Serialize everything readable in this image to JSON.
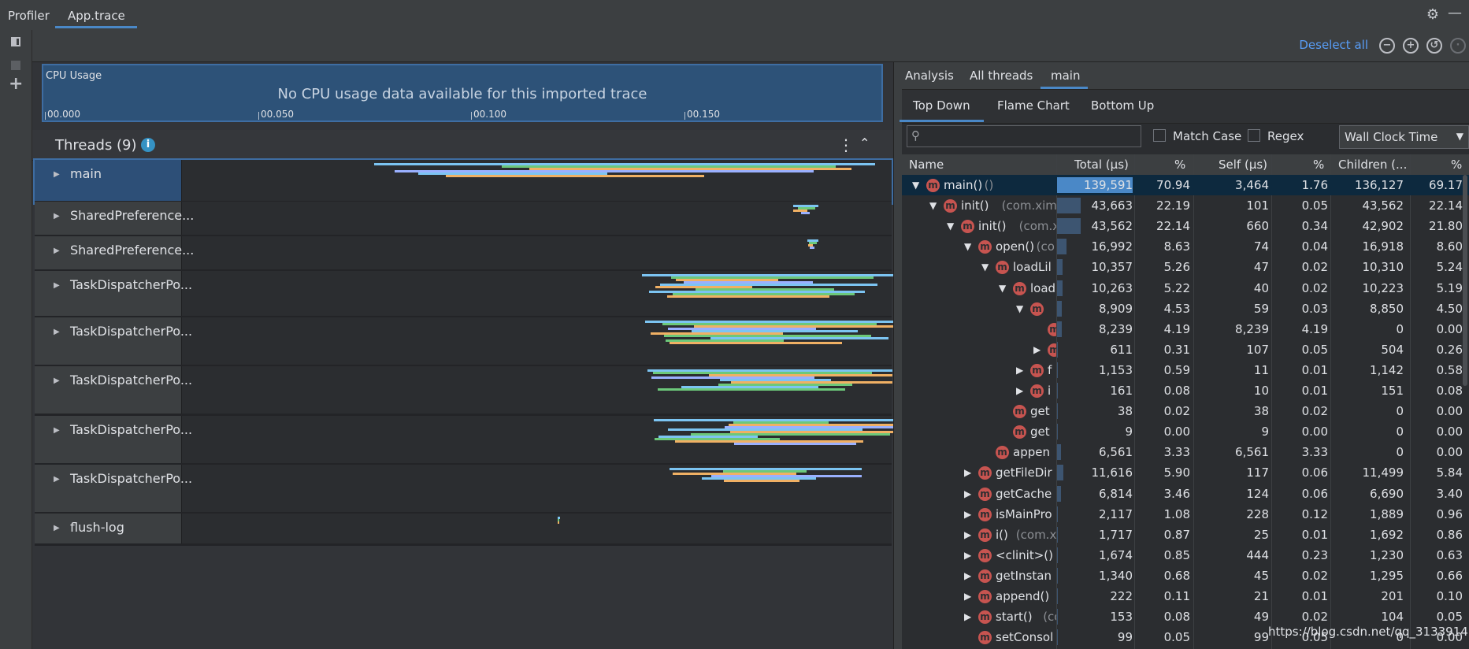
{
  "window": {
    "tabs": [
      "Profiler",
      "App.trace"
    ],
    "active_tab": "App.trace"
  },
  "toolbar": {
    "deselect_all": "Deselect all",
    "icons": [
      "zoom-out-icon",
      "zoom-in-icon",
      "reset-zoom-icon",
      "jump-to-live-icon"
    ]
  },
  "left_rail": {
    "icons": [
      "sessions-panel-icon",
      "stop-icon",
      "add-icon"
    ]
  },
  "cpu_usage": {
    "label": "CPU Usage",
    "message": "No CPU usage data available for this imported trace",
    "ticks": [
      "00.000",
      "00.050",
      "00.100",
      "00.150"
    ]
  },
  "threads": {
    "title": "Threads (9)",
    "rows": [
      {
        "name": "main"
      },
      {
        "name": "SharedPreference..."
      },
      {
        "name": "SharedPreference..."
      },
      {
        "name": "TaskDispatcherPo..."
      },
      {
        "name": "TaskDispatcherPo..."
      },
      {
        "name": "TaskDispatcherPo..."
      },
      {
        "name": "TaskDispatcherPo..."
      },
      {
        "name": "TaskDispatcherPo..."
      },
      {
        "name": "flush-log"
      }
    ]
  },
  "analysis": {
    "tabs": [
      "Analysis",
      "All threads",
      "main"
    ],
    "active_tab": "main",
    "subtabs": [
      "Top Down",
      "Flame Chart",
      "Bottom Up"
    ],
    "active_subtab": "Top Down",
    "search_placeholder": "",
    "match_case_label": "Match Case",
    "regex_label": "Regex",
    "clock_select": "Wall Clock Time",
    "columns": [
      "Name",
      "Total (μs)",
      "%",
      "Self (μs)",
      "%",
      "Children (...",
      "%"
    ],
    "rows": [
      {
        "name": "main()",
        "extra": " ()",
        "total": "139,591",
        "tpct": "70.94",
        "self": "3,464",
        "spct": "1.76",
        "children": "136,127",
        "cpct": "69.17"
      },
      {
        "name": "init()",
        "extra": " (com.ximal",
        "total": "43,663",
        "tpct": "22.19",
        "self": "101",
        "spct": "0.05",
        "children": "43,562",
        "cpct": "22.14"
      },
      {
        "name": "init()",
        "extra": " (com.xi",
        "total": "43,562",
        "tpct": "22.14",
        "self": "660",
        "spct": "0.34",
        "children": "42,902",
        "cpct": "21.80"
      },
      {
        "name": "open()",
        "extra": " (co",
        "total": "16,992",
        "tpct": "8.63",
        "self": "74",
        "spct": "0.04",
        "children": "16,918",
        "cpct": "8.60"
      },
      {
        "name": "loadLil",
        "extra": "",
        "total": "10,357",
        "tpct": "5.26",
        "self": "47",
        "spct": "0.02",
        "children": "10,310",
        "cpct": "5.24"
      },
      {
        "name": "load",
        "extra": "",
        "total": "10,263",
        "tpct": "5.22",
        "self": "40",
        "spct": "0.02",
        "children": "10,223",
        "cpct": "5.19"
      },
      {
        "name": "",
        "extra": "",
        "total": "8,909",
        "tpct": "4.53",
        "self": "59",
        "spct": "0.03",
        "children": "8,850",
        "cpct": "4.50"
      },
      {
        "name": "",
        "extra": "",
        "total": "8,239",
        "tpct": "4.19",
        "self": "8,239",
        "spct": "4.19",
        "children": "0",
        "cpct": "0.00"
      },
      {
        "name": "",
        "extra": "",
        "total": "611",
        "tpct": "0.31",
        "self": "107",
        "spct": "0.05",
        "children": "504",
        "cpct": "0.26"
      },
      {
        "name": "f",
        "extra": "",
        "total": "1,153",
        "tpct": "0.59",
        "self": "11",
        "spct": "0.01",
        "children": "1,142",
        "cpct": "0.58"
      },
      {
        "name": "i",
        "extra": "",
        "total": "161",
        "tpct": "0.08",
        "self": "10",
        "spct": "0.01",
        "children": "151",
        "cpct": "0.08"
      },
      {
        "name": "get",
        "extra": "",
        "total": "38",
        "tpct": "0.02",
        "self": "38",
        "spct": "0.02",
        "children": "0",
        "cpct": "0.00"
      },
      {
        "name": "get",
        "extra": "",
        "total": "9",
        "tpct": "0.00",
        "self": "9",
        "spct": "0.00",
        "children": "0",
        "cpct": "0.00"
      },
      {
        "name": "appen",
        "extra": "",
        "total": "6,561",
        "tpct": "3.33",
        "self": "6,561",
        "spct": "3.33",
        "children": "0",
        "cpct": "0.00"
      },
      {
        "name": "getFileDir",
        "extra": "",
        "total": "11,616",
        "tpct": "5.90",
        "self": "117",
        "spct": "0.06",
        "children": "11,499",
        "cpct": "5.84"
      },
      {
        "name": "getCache",
        "extra": "",
        "total": "6,814",
        "tpct": "3.46",
        "self": "124",
        "spct": "0.06",
        "children": "6,690",
        "cpct": "3.40"
      },
      {
        "name": "isMainPro",
        "extra": "",
        "total": "2,117",
        "tpct": "1.08",
        "self": "228",
        "spct": "0.12",
        "children": "1,889",
        "cpct": "0.96"
      },
      {
        "name": "i()",
        "extra": " (com.xi",
        "total": "1,717",
        "tpct": "0.87",
        "self": "25",
        "spct": "0.01",
        "children": "1,692",
        "cpct": "0.86"
      },
      {
        "name": "<clinit>()",
        "extra": "",
        "total": "1,674",
        "tpct": "0.85",
        "self": "444",
        "spct": "0.23",
        "children": "1,230",
        "cpct": "0.63"
      },
      {
        "name": "getInstan",
        "extra": "",
        "total": "1,340",
        "tpct": "0.68",
        "self": "45",
        "spct": "0.02",
        "children": "1,295",
        "cpct": "0.66"
      },
      {
        "name": "append()",
        "extra": "",
        "total": "222",
        "tpct": "0.11",
        "self": "21",
        "spct": "0.01",
        "children": "201",
        "cpct": "0.10"
      },
      {
        "name": "start()",
        "extra": " (co",
        "total": "153",
        "tpct": "0.08",
        "self": "49",
        "spct": "0.02",
        "children": "104",
        "cpct": "0.05"
      },
      {
        "name": "setConsol",
        "extra": "",
        "total": "99",
        "tpct": "0.05",
        "self": "99",
        "spct": "0.05",
        "children": "0",
        "cpct": "0.00"
      }
    ]
  },
  "watermark": "https://blog.csdn.net/qq_31339141",
  "colors": {
    "accent": "#4a88c7",
    "link": "#589df6",
    "method_badge": "#c75450",
    "selected_row": "#0d293e",
    "bar_fill": "#3d5571",
    "bar_fill_selected": "#4a88c7"
  }
}
